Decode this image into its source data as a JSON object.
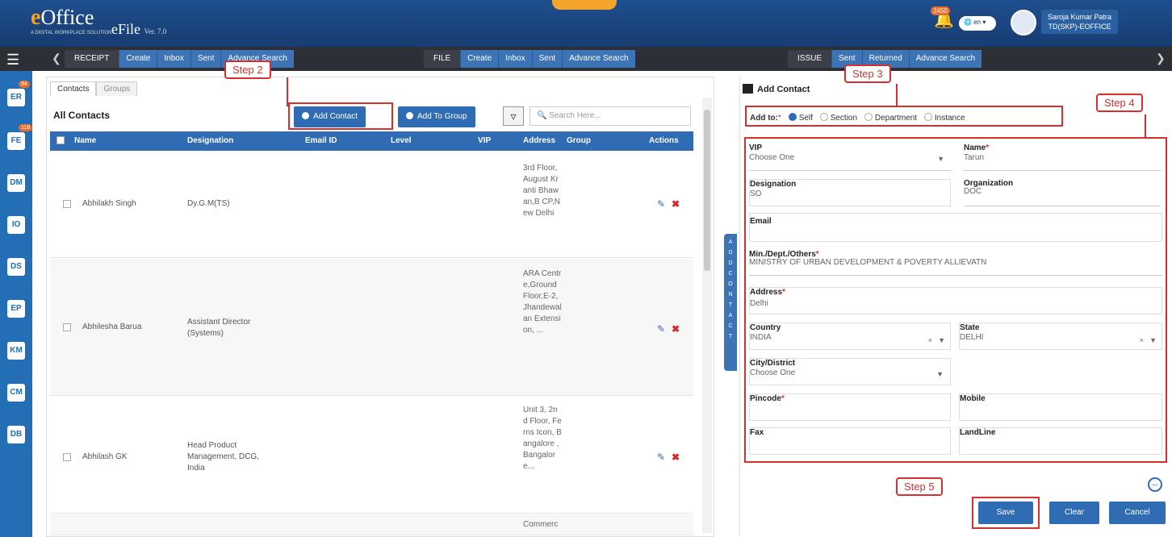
{
  "app": {
    "logo_e": "e",
    "logo_office": "Office",
    "logo_tag": "A DIGITAL WORKPLACE SOLUTION",
    "efile": "eFile",
    "version": "Ver. 7.0",
    "notification_count": "2450",
    "language": "en",
    "user_name": "Saroja Kumar Patra",
    "user_role": "TD(SKP)-EOFFICE"
  },
  "nav": {
    "receipt": {
      "label": "RECEIPT",
      "items": [
        "Create",
        "Inbox",
        "Sent",
        "Advance Search"
      ]
    },
    "file": {
      "label": "FILE",
      "items": [
        "Create",
        "Inbox",
        "Sent",
        "Advance Search"
      ]
    },
    "issue": {
      "label": "ISSUE",
      "items": [
        "Sent",
        "Returned",
        "Advance Search"
      ]
    }
  },
  "sidebar": {
    "badges": [
      "94",
      "118"
    ],
    "items": [
      "ER",
      "FE",
      "DM",
      "IO",
      "DS",
      "EP",
      "KM",
      "CM",
      "DB"
    ]
  },
  "contacts": {
    "tabs": [
      "Contacts",
      "Groups"
    ],
    "title": "All Contacts",
    "add_contact": "Add Contact",
    "add_to_group": "Add To Group",
    "search_placeholder": "Search Here...",
    "columns": [
      "Name",
      "Designation",
      "Email ID",
      "Level",
      "VIP",
      "Address",
      "Group",
      "Actions"
    ],
    "rows": [
      {
        "name": "Abhilakh Singh",
        "designation": "Dy.G.M(TS)",
        "address": "3rd Floor,August Kranti Bhawan,B CP,New Delhi"
      },
      {
        "name": "Abhilesha Barua",
        "designation": "Assistant Director (Systems)",
        "address": "ARA Centre,Ground Floor,E-2,Jhandewalan Extension, ..."
      },
      {
        "name": "Abhilash GK",
        "designation": "Head Product Management, DCG, India",
        "address": "Unit 3, 2nd Floor, Ferns Icon, Bangalore ,Bangalore..."
      },
      {
        "name": "",
        "designation": "",
        "address": "Commerc"
      }
    ]
  },
  "steps": {
    "s2": "Step 2",
    "s3": "Step 3",
    "s4": "Step 4",
    "s5": "Step 5"
  },
  "form": {
    "title": "Add Contact",
    "side_tab": "ADD CONTACT",
    "add_to_label": "Add to:",
    "add_to_options": [
      "Self",
      "Section",
      "Department",
      "Instance"
    ],
    "vip_label": "VIP",
    "vip_value": "Choose One",
    "name_label": "Name",
    "name_value": "Tarun",
    "designation_label": "Designation",
    "designation_value": "SO",
    "organization_label": "Organization",
    "organization_value": "DOC",
    "email_label": "Email",
    "ministry_label": "Min./Dept./Others",
    "ministry_value": "MINISTRY OF URBAN DEVELOPMENT & POVERTY ALLIEVATN",
    "address_label": "Address",
    "address_value": "Delhi",
    "country_label": "Country",
    "country_value": "INDIA",
    "state_label": "State",
    "state_value": "DELHI",
    "city_label": "City/District",
    "city_value": "Choose One",
    "pincode_label": "Pincode",
    "mobile_label": "Mobile",
    "fax_label": "Fax",
    "landline_label": "LandLine",
    "save": "Save",
    "clear": "Clear",
    "cancel": "Cancel"
  }
}
